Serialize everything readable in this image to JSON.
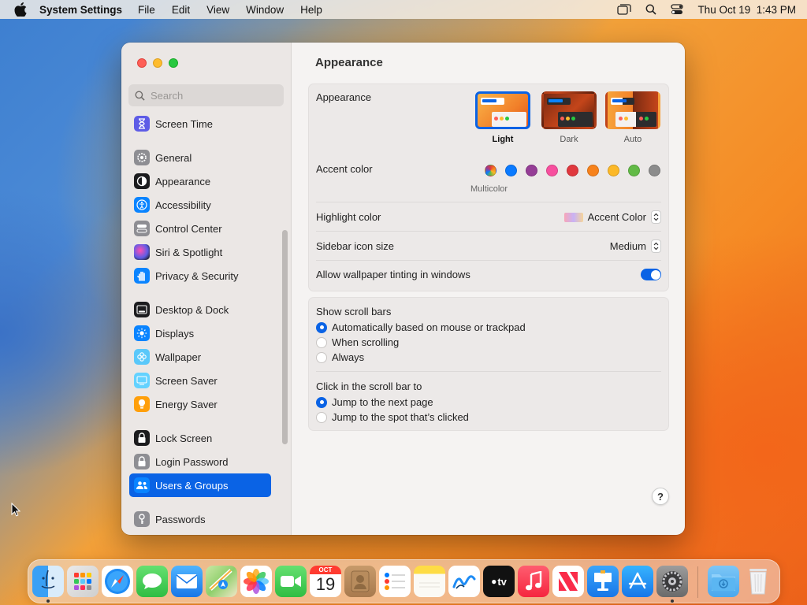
{
  "menubar": {
    "app_name": "System Settings",
    "menus": [
      "File",
      "Edit",
      "View",
      "Window",
      "Help"
    ],
    "clock": "Thu Oct 19  1:43 PM",
    "status_icons": [
      "window-switcher-icon",
      "search-icon",
      "control-center-icon"
    ]
  },
  "sidebar": {
    "search_placeholder": "Search",
    "items": [
      {
        "label": "Screen Time",
        "icon": "hourglass-icon",
        "color": "#5e5ce6"
      },
      {
        "label": "General",
        "icon": "gear-icon",
        "color": "#8e8e93"
      },
      {
        "label": "Appearance",
        "icon": "appearance-icon",
        "color": "#1c1c1e"
      },
      {
        "label": "Accessibility",
        "icon": "accessibility-icon",
        "color": "#0a84ff"
      },
      {
        "label": "Control Center",
        "icon": "control-center-icon",
        "color": "#8e8e93"
      },
      {
        "label": "Siri & Spotlight",
        "icon": "siri-icon",
        "color": "#bf5af2"
      },
      {
        "label": "Privacy & Security",
        "icon": "hand-icon",
        "color": "#0a84ff"
      },
      {
        "label": "Desktop & Dock",
        "icon": "dock-icon",
        "color": "#1c1c1e"
      },
      {
        "label": "Displays",
        "icon": "sun-icon",
        "color": "#0a84ff"
      },
      {
        "label": "Wallpaper",
        "icon": "flower-icon",
        "color": "#5ac8fa"
      },
      {
        "label": "Screen Saver",
        "icon": "screen-saver-icon",
        "color": "#64d2ff"
      },
      {
        "label": "Energy Saver",
        "icon": "bulb-icon",
        "color": "#ff9f0a"
      },
      {
        "label": "Lock Screen",
        "icon": "lock-icon",
        "color": "#1c1c1e"
      },
      {
        "label": "Login Password",
        "icon": "lock-icon",
        "color": "#8e8e93"
      },
      {
        "label": "Users & Groups",
        "icon": "users-icon",
        "color": "#0a84ff"
      },
      {
        "label": "Passwords",
        "icon": "key-icon",
        "color": "#8e8e93"
      }
    ],
    "selected": "Users & Groups"
  },
  "main": {
    "title": "Appearance",
    "appearance": {
      "label": "Appearance",
      "options": [
        "Light",
        "Dark",
        "Auto"
      ],
      "selected": "Light"
    },
    "accent": {
      "label": "Accent color",
      "caption": "Multicolor",
      "colors": [
        "multicolor",
        "#0a7aff",
        "#953d96",
        "#f74f9e",
        "#e0383e",
        "#f7821b",
        "#fcb827",
        "#62ba46",
        "#8c8c8c"
      ]
    },
    "highlight": {
      "label": "Highlight color",
      "value": "Accent Color"
    },
    "sidebar_icon_size": {
      "label": "Sidebar icon size",
      "value": "Medium"
    },
    "wallpaper_tinting": {
      "label": "Allow wallpaper tinting in windows",
      "enabled": true
    },
    "scroll_bars": {
      "label": "Show scroll bars",
      "options": [
        "Automatically based on mouse or trackpad",
        "When scrolling",
        "Always"
      ],
      "selected": "Automatically based on mouse or trackpad"
    },
    "click_scroll": {
      "label": "Click in the scroll bar to",
      "options": [
        "Jump to the next page",
        "Jump to the spot that’s clicked"
      ],
      "selected": "Jump to the next page"
    },
    "help": "?"
  },
  "dock": {
    "apps": [
      "Finder",
      "Launchpad",
      "Safari",
      "Messages",
      "Mail",
      "Maps",
      "Photos",
      "FaceTime",
      "Calendar",
      "Contacts",
      "Reminders",
      "Notes",
      "Freeform",
      "TV",
      "Music",
      "News",
      "Keynote",
      "App Store",
      "System Settings",
      "Downloads",
      "Trash"
    ],
    "calendar": {
      "month": "OCT",
      "day": "19"
    },
    "tv_label": "tv"
  }
}
